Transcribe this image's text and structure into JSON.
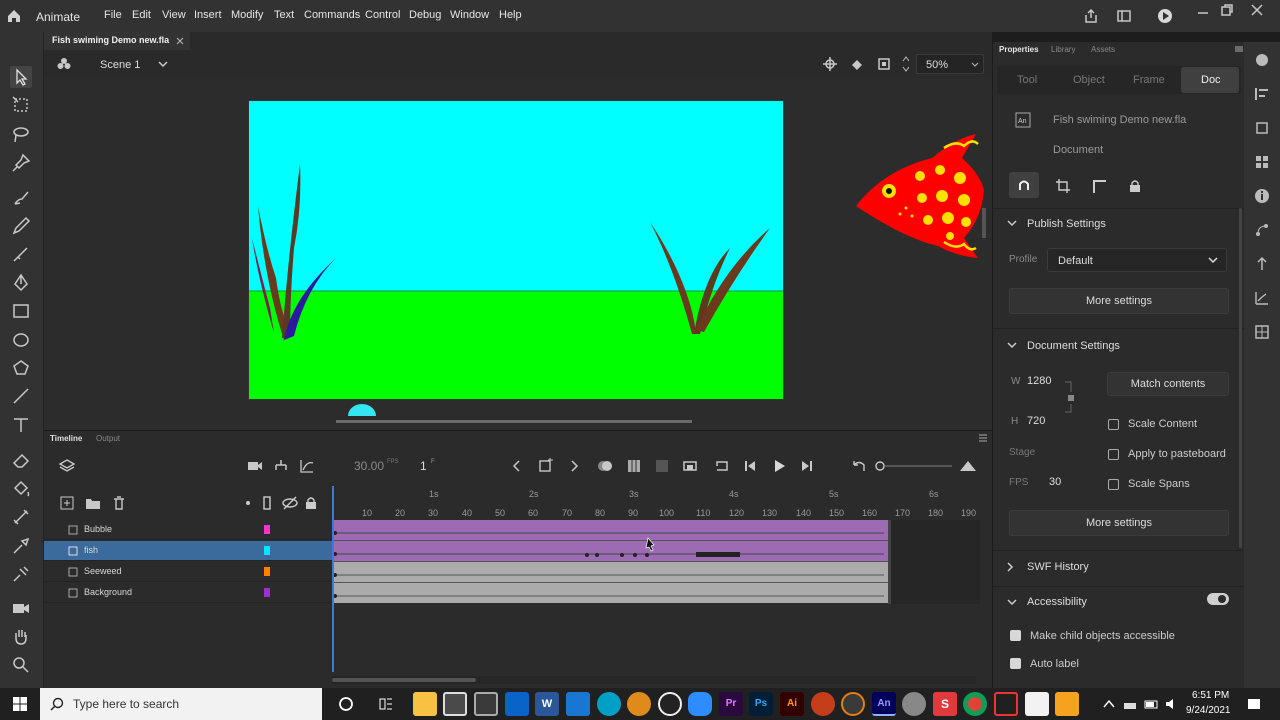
{
  "app": {
    "name": "Animate"
  },
  "menu": [
    "File",
    "Edit",
    "View",
    "Insert",
    "Modify",
    "Text",
    "Commands",
    "Control",
    "Debug",
    "Window",
    "Help"
  ],
  "document": {
    "tab_name": "Fish swiming Demo new.fla",
    "scene": "Scene 1",
    "zoom": "50%"
  },
  "stage": {
    "colors": {
      "sky": "#00FFFF",
      "ground": "#00FF00",
      "seaweed": "#6B3A1E",
      "fish_body": "#FF0000",
      "fish_spots": "#FFE000",
      "bubble": "#33E6F0"
    }
  },
  "timeline": {
    "tabs": [
      "Timeline",
      "Output"
    ],
    "fps_value": "30.00",
    "fps_unit": "FPS",
    "current_frame": "1",
    "frame_suffix": "F",
    "seconds": [
      "1s",
      "2s",
      "3s",
      "4s",
      "5s",
      "6s"
    ],
    "frames": [
      "10",
      "20",
      "30",
      "40",
      "50",
      "60",
      "70",
      "80",
      "90",
      "100",
      "110",
      "120",
      "130",
      "140",
      "150",
      "160",
      "170",
      "180",
      "190"
    ],
    "layers": [
      {
        "name": "Bubble",
        "color": "#FF33CC"
      },
      {
        "name": "fish",
        "color": "#00E5FF"
      },
      {
        "name": "Seeweed",
        "color": "#FF8000"
      },
      {
        "name": "Background",
        "color": "#9B30D9"
      }
    ]
  },
  "properties": {
    "panel_tabs": [
      "Properties",
      "Library",
      "Assets"
    ],
    "mode_tabs": [
      "Tool",
      "Object",
      "Frame",
      "Doc"
    ],
    "file_name": "Fish swiming Demo new.fla",
    "file_type": "Document",
    "publish": {
      "title": "Publish Settings",
      "profile_label": "Profile",
      "profile_value": "Default",
      "more_settings": "More settings"
    },
    "doc_settings": {
      "title": "Document Settings",
      "w_label": "W",
      "w_value": "1280",
      "h_label": "H",
      "h_value": "720",
      "match_contents": "Match contents",
      "scale_content": "Scale Content",
      "stage_label": "Stage",
      "apply_pasteboard": "Apply to pasteboard",
      "fps_label": "FPS",
      "fps_value": "30",
      "scale_spans": "Scale Spans",
      "more_settings": "More settings"
    },
    "swf_history": "SWF History",
    "accessibility": {
      "title": "Accessibility",
      "make_child": "Make child objects accessible",
      "auto_label": "Auto label"
    }
  },
  "taskbar": {
    "search_placeholder": "Type here to search",
    "time": "6:51 PM",
    "date": "9/24/2021"
  }
}
